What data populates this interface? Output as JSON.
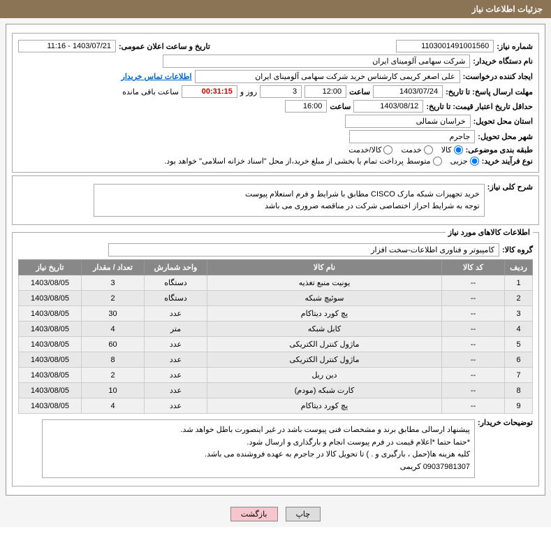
{
  "title": "جزئیات اطلاعات نیاز",
  "fields": {
    "need_number_label": "شماره نیاز:",
    "need_number": "1103001491001560",
    "announce_label": "تاریخ و ساعت اعلان عمومی:",
    "announce": "1403/07/21 - 11:16",
    "buyer_org_label": "نام دستگاه خریدار:",
    "buyer_org": "شرکت سهامی آلومینای ایران",
    "requester_label": "ایجاد کننده درخواست:",
    "requester": "علی اصغر کریمی کارشناس خرید شرکت سهامی آلومینای ایران",
    "contact_link": "اطلاعات تماس خریدار",
    "deadline_reply_label": "مهلت ارسال پاسخ: تا تاریخ:",
    "deadline_reply": "1403/07/24",
    "time_label": "ساعت",
    "deadline_reply_time": "12:00",
    "days_remaining": "3",
    "days_and": "روز و",
    "time_remaining": "00:31:15",
    "remaining_label": "ساعت باقی مانده",
    "price_validity_label": "حداقل تاریخ اعتبار قیمت: تا تاریخ:",
    "price_validity": "1403/08/12",
    "price_validity_time": "16:00",
    "delivery_province_label": "استان محل تحویل:",
    "delivery_province": "خراسان شمالی",
    "delivery_city_label": "شهر محل تحویل:",
    "delivery_city": "جاجرم",
    "category_label": "طبقه بندی موضوعی:",
    "cat_goods": "کالا",
    "cat_service": "خدمت",
    "cat_both": "کالا/خدمت",
    "purchase_type_label": "نوع فرآیند خرید:",
    "pt_partial": "جزیی",
    "pt_medium": "متوسط",
    "payment_note": "پرداخت تمام یا بخشی از مبلغ خرید،از محل \"اسناد خزانه اسلامی\" خواهد بود.",
    "general_desc_label": "شرح کلی نیاز:",
    "general_desc": "خرید تجهیزات شبکه مارک CISCO مطابق با شرایط و فرم استعلام پیوست\nتوجه به شرایط احراز اختصاصی شرکت در مناقصه ضروری می باشد",
    "items_section": "اطلاعات کالاهای مورد نیاز",
    "goods_group_label": "گروه کالا:",
    "goods_group": "کامپیوتر و فناوری اطلاعات-سخت افزار",
    "buyer_notes_label": "توضیحات خریدار:",
    "buyer_notes": "پیشنهاد ارسالی مطابق برند و مشخصات فنی پیوست باشد در غیر اینصورت باطل خواهد شد.\n*حتما حتما *اعلام قیمت در فرم پیوست انجام و بارگذاری و ارسال شود.\nکلیه هزینه ها(حمل ، بارگیری و . ) تا تحویل کالا در جاجرم به عهده فروشنده می باشد.\n09037981307 کریمی",
    "btn_print": "چاپ",
    "btn_back": "بازگشت"
  },
  "table": {
    "headers": [
      "ردیف",
      "کد کالا",
      "نام کالا",
      "واحد شمارش",
      "تعداد / مقدار",
      "تاریخ نیاز"
    ],
    "rows": [
      {
        "n": "1",
        "code": "--",
        "name": "یونیت منبع تغذیه",
        "unit": "دستگاه",
        "qty": "3",
        "date": "1403/08/05"
      },
      {
        "n": "2",
        "code": "--",
        "name": "سوئیچ شبکه",
        "unit": "دستگاه",
        "qty": "2",
        "date": "1403/08/05"
      },
      {
        "n": "3",
        "code": "--",
        "name": "پچ کورد دیتاکام",
        "unit": "عدد",
        "qty": "30",
        "date": "1403/08/05"
      },
      {
        "n": "4",
        "code": "--",
        "name": "کابل شبکه",
        "unit": "متر",
        "qty": "4",
        "date": "1403/08/05"
      },
      {
        "n": "5",
        "code": "--",
        "name": "ماژول کنترل الکتریکی",
        "unit": "عدد",
        "qty": "60",
        "date": "1403/08/05"
      },
      {
        "n": "6",
        "code": "--",
        "name": "ماژول کنترل الکتریکی",
        "unit": "عدد",
        "qty": "8",
        "date": "1403/08/05"
      },
      {
        "n": "7",
        "code": "--",
        "name": "دین ریل",
        "unit": "عدد",
        "qty": "2",
        "date": "1403/08/05"
      },
      {
        "n": "8",
        "code": "--",
        "name": "کارت شبکه (مودم)",
        "unit": "عدد",
        "qty": "10",
        "date": "1403/08/05"
      },
      {
        "n": "9",
        "code": "--",
        "name": "پچ کورد دیتاکام",
        "unit": "عدد",
        "qty": "4",
        "date": "1403/08/05"
      }
    ]
  }
}
